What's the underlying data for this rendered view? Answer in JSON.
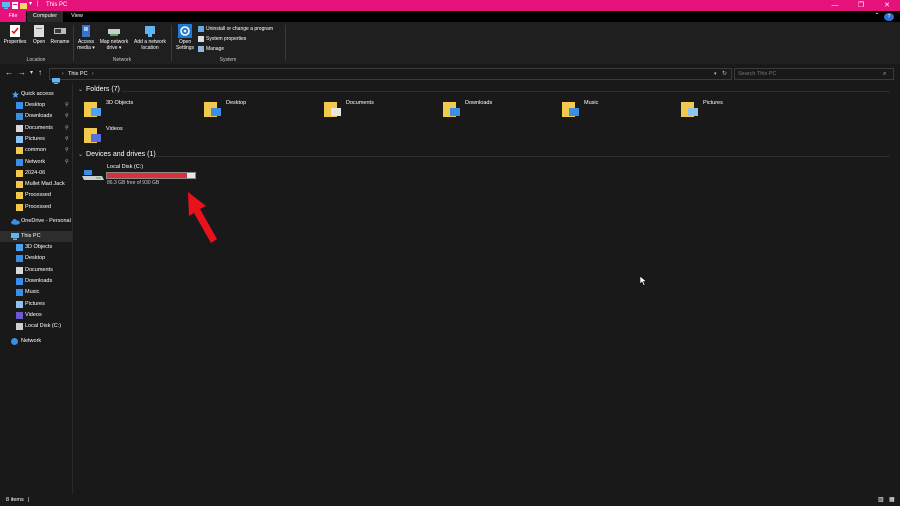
{
  "window": {
    "title": "This PC",
    "controls": {
      "minimize": "—",
      "maximize": "❐",
      "close": "✕"
    }
  },
  "ribbon_tabs": {
    "file": "File",
    "computer": "Computer",
    "view": "View",
    "help": "?"
  },
  "ribbon": {
    "location": {
      "properties": "Properties",
      "open": "Open",
      "rename": "Rename",
      "group_label": "Location"
    },
    "network": {
      "access_media": "Access media ▾",
      "map_network_drive": "Map network drive ▾",
      "add_network_location": "Add a network location",
      "group_label": "Network"
    },
    "system": {
      "open_settings": "Open Settings",
      "uninstall": "Uninstall or change a program",
      "system_properties": "System properties",
      "manage": "Manage",
      "group_label": "System"
    }
  },
  "address": {
    "crumb": "This PC",
    "search_placeholder": "Search This PC"
  },
  "nav": {
    "quick_access": "Quick access",
    "quick_items": [
      {
        "label": "Desktop",
        "icon": "desktop-icon",
        "pinned": true
      },
      {
        "label": "Downloads",
        "icon": "downloads-icon",
        "pinned": true
      },
      {
        "label": "Documents",
        "icon": "documents-icon",
        "pinned": true
      },
      {
        "label": "Pictures",
        "icon": "pictures-icon",
        "pinned": true
      },
      {
        "label": "common",
        "icon": "folder-icon",
        "pinned": true
      },
      {
        "label": "Network",
        "icon": "network-icon",
        "pinned": true
      },
      {
        "label": "2024-06",
        "icon": "folder-icon",
        "pinned": false
      },
      {
        "label": "Mullet Mad Jack",
        "icon": "folder-icon",
        "pinned": false
      },
      {
        "label": "Processed",
        "icon": "folder-icon",
        "pinned": false
      },
      {
        "label": "Processed",
        "icon": "folder-icon",
        "pinned": false
      }
    ],
    "onedrive": "OneDrive - Personal",
    "this_pc": "This PC",
    "pc_items": [
      {
        "label": "3D Objects",
        "icon": "3d-objects-icon"
      },
      {
        "label": "Desktop",
        "icon": "desktop-icon"
      },
      {
        "label": "Documents",
        "icon": "documents-icon"
      },
      {
        "label": "Downloads",
        "icon": "downloads-icon"
      },
      {
        "label": "Music",
        "icon": "music-icon"
      },
      {
        "label": "Pictures",
        "icon": "pictures-icon"
      },
      {
        "label": "Videos",
        "icon": "videos-icon"
      },
      {
        "label": "Local Disk (C:)",
        "icon": "drive-icon"
      }
    ],
    "network": "Network"
  },
  "content": {
    "folders_header": "Folders (7)",
    "folders": [
      {
        "label": "3D Objects",
        "icon": "3d-objects-folder-icon"
      },
      {
        "label": "Desktop",
        "icon": "desktop-folder-icon"
      },
      {
        "label": "Documents",
        "icon": "documents-folder-icon"
      },
      {
        "label": "Downloads",
        "icon": "downloads-folder-icon"
      },
      {
        "label": "Music",
        "icon": "music-folder-icon"
      },
      {
        "label": "Pictures",
        "icon": "pictures-folder-icon"
      },
      {
        "label": "Videos",
        "icon": "videos-folder-icon"
      }
    ],
    "devices_header": "Devices and drives (1)",
    "drive": {
      "label": "Local Disk (C:)",
      "free_text": "86.3 GB free of 930 GB",
      "used_fraction": 0.907,
      "bar_color": "#da2f3c"
    }
  },
  "status": {
    "items": "8 items"
  },
  "colors": {
    "accent": "#e5127c",
    "background": "#191919",
    "annotation_arrow": "#e8121c"
  }
}
